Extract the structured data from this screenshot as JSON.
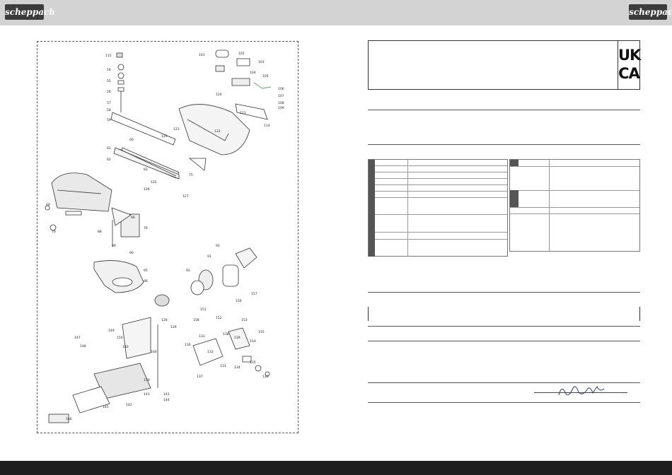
{
  "header": {
    "logo_left": "scheppach",
    "logo_right": "scheppach"
  },
  "certification": {
    "mark_line1": "UK",
    "mark_line2": "CA"
  },
  "diagram": {
    "labels": [
      "115",
      "16",
      "19",
      "33",
      "54",
      "55",
      "56",
      "57",
      "58",
      "59",
      "60",
      "61",
      "62",
      "66",
      "69",
      "70",
      "75",
      "76",
      "82",
      "88",
      "89",
      "90",
      "91",
      "92",
      "93",
      "95",
      "96",
      "101",
      "102",
      "103",
      "104",
      "105",
      "106",
      "107",
      "108",
      "109",
      "110",
      "111",
      "112",
      "113",
      "114",
      "116",
      "117",
      "118",
      "119",
      "120",
      "121",
      "122",
      "123",
      "124",
      "125",
      "126",
      "127",
      "128",
      "129",
      "130",
      "131",
      "132",
      "133",
      "134",
      "135",
      "136",
      "137",
      "138",
      "139",
      "140",
      "141",
      "142",
      "143",
      "144",
      "145",
      "146",
      "147",
      "148",
      "149",
      "150",
      "151",
      "152",
      "153",
      "154",
      "155",
      "156",
      "157",
      "158",
      "159",
      "160"
    ]
  },
  "spec_table": {
    "left_rows": 12,
    "right_rows": 6
  }
}
